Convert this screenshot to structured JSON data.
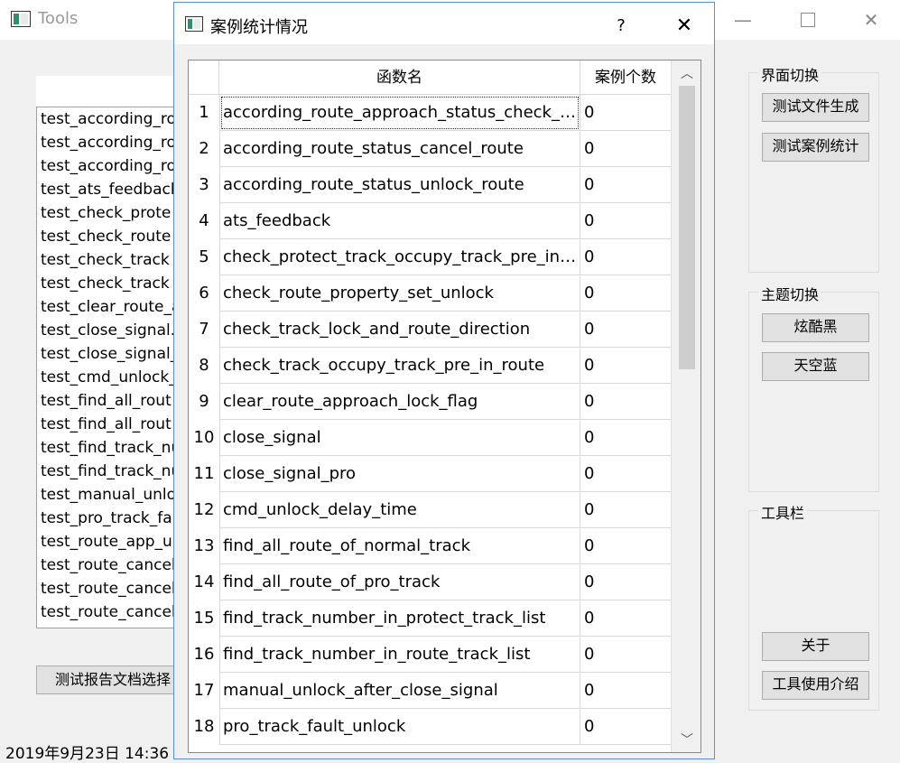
{
  "main_window": {
    "title": "Tools",
    "min_glyph": "—",
    "close_glyph": "✕",
    "test_list": [
      "test_according_ro",
      "test_according_ro",
      "test_according_ro",
      "test_ats_feedback",
      "test_check_prote",
      "test_check_route",
      "test_check_track",
      "test_check_track",
      "test_clear_route_a",
      "test_close_signal.",
      "test_close_signal_",
      "test_cmd_unlock_",
      "test_find_all_rout",
      "test_find_all_rout",
      "test_find_track_nu",
      "test_find_track_nu",
      "test_manual_unlo",
      "test_pro_track_fa",
      "test_route_app_u",
      "test_route_cancel",
      "test_route_cancel",
      "test_route_cancel"
    ],
    "report_select_button": "测试报告文档选择",
    "datetime": "2019年9月23日 14:36"
  },
  "groups": {
    "ui_switch": {
      "title": "界面切换",
      "buttons": [
        "测试文件生成",
        "测试案例统计"
      ]
    },
    "theme_switch": {
      "title": "主题切换",
      "buttons": [
        "炫酷黑",
        "天空蓝"
      ]
    },
    "toolbar": {
      "title": "工具栏",
      "buttons": [
        "关于",
        "工具使用介绍"
      ]
    }
  },
  "dialog": {
    "title": "案例统计情况",
    "help_glyph": "?",
    "close_glyph": "✕",
    "table": {
      "headers": [
        "函数名",
        "案例个数"
      ],
      "rows": [
        {
          "num": "1",
          "func": "according_route_approach_status_check_tr...",
          "count": "0"
        },
        {
          "num": "2",
          "func": "according_route_status_cancel_route",
          "count": "0"
        },
        {
          "num": "3",
          "func": "according_route_status_unlock_route",
          "count": "0"
        },
        {
          "num": "4",
          "func": "ats_feedback",
          "count": "0"
        },
        {
          "num": "5",
          "func": "check_protect_track_occupy_track_pre_in_r...",
          "count": "0"
        },
        {
          "num": "6",
          "func": "check_route_property_set_unlock",
          "count": "0"
        },
        {
          "num": "7",
          "func": "check_track_lock_and_route_direction",
          "count": "0"
        },
        {
          "num": "8",
          "func": "check_track_occupy_track_pre_in_route",
          "count": "0"
        },
        {
          "num": "9",
          "func": "clear_route_approach_lock_flag",
          "count": "0"
        },
        {
          "num": "10",
          "func": "close_signal",
          "count": "0"
        },
        {
          "num": "11",
          "func": "close_signal_pro",
          "count": "0"
        },
        {
          "num": "12",
          "func": "cmd_unlock_delay_time",
          "count": "0"
        },
        {
          "num": "13",
          "func": "find_all_route_of_normal_track",
          "count": "0"
        },
        {
          "num": "14",
          "func": "find_all_route_of_pro_track",
          "count": "0"
        },
        {
          "num": "15",
          "func": "find_track_number_in_protect_track_list",
          "count": "0"
        },
        {
          "num": "16",
          "func": "find_track_number_in_route_track_list",
          "count": "0"
        },
        {
          "num": "17",
          "func": "manual_unlock_after_close_signal",
          "count": "0"
        },
        {
          "num": "18",
          "func": "pro_track_fault_unlock",
          "count": "0"
        }
      ]
    }
  }
}
